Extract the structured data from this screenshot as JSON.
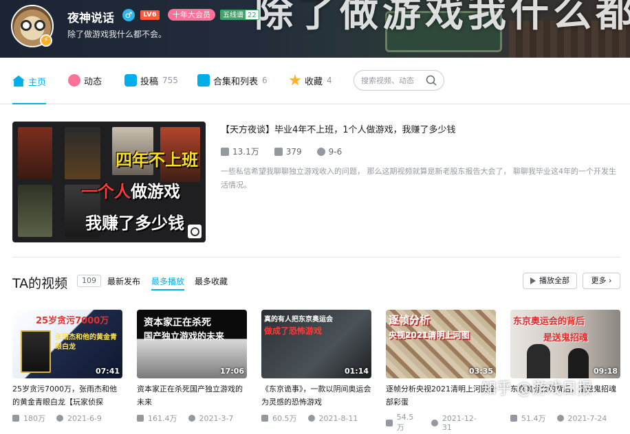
{
  "banner": {
    "background_text": "除了做游戏我什么都不会"
  },
  "user": {
    "name": "夜神说话",
    "sign": "除了做游戏我什么都不会。",
    "gender_icon": "male-icon",
    "level": "LV6",
    "vip": "十年大会员",
    "medal_name": "五线谱",
    "medal_level": "22"
  },
  "nav": {
    "items": [
      {
        "label": "主页",
        "count": "",
        "icon": "home-icon"
      },
      {
        "label": "动态",
        "count": "",
        "icon": "dynamic-icon"
      },
      {
        "label": "投稿",
        "count": "755",
        "icon": "upload-icon"
      },
      {
        "label": "合集和列表",
        "count": "6",
        "icon": "collection-icon"
      },
      {
        "label": "收藏",
        "count": "4",
        "icon": "star-icon"
      }
    ],
    "search_placeholder": "搜索视频、动态"
  },
  "featured": {
    "thumb_line1": "四年不上班",
    "thumb_line2_red": "一个人",
    "thumb_line2_rest": "做游戏",
    "thumb_line3": "我赚了多少钱",
    "title": "【天方夜谈】毕业4年不上班，1个人做游戏，我赚了多少钱",
    "views": "13.1万",
    "comments": "379",
    "date": "9-6",
    "desc": "一些私信希望我聊聊独立游戏收入的问题， 那么这期视频就算是新老股东报告大会了， 聊聊我毕业这4年的一个开发生活情况。"
  },
  "videos_section": {
    "title": "TA的视频",
    "count": "109",
    "sort_tabs": [
      "最新发布",
      "最多播放",
      "最多收藏"
    ],
    "active_sort": "最多播放",
    "play_all": "播放全部",
    "more": "更多"
  },
  "videos": [
    {
      "thumb_text": "25岁贪污7000万",
      "thumb_sub": "张雨杰和他的黄金青眼白龙",
      "duration": "07:41",
      "title": "25岁贪污7000万，张雨杰和他的黄金青眼白龙【玩家侦探",
      "views": "180万",
      "date": "2021-6-9"
    },
    {
      "thumb_text": "资本家正在杀死",
      "thumb_sub": "国产独立游戏的未来",
      "duration": "17:06",
      "title": "资本家正在杀死国产独立游戏的未来",
      "views": "161.4万",
      "date": "2021-3-7"
    },
    {
      "thumb_text": "真的有人把东京奥运会",
      "thumb_sub": "做成了恐怖游戏",
      "duration": "01:14",
      "title": "《东京诡事》，一款以阴间奥运会为灵感的恐怖游戏",
      "views": "60.5万",
      "date": "2021-8-11"
    },
    {
      "thumb_text": "逐帧分析",
      "thumb_sub": "央视2021清明上河图",
      "duration": "03:35",
      "title": "逐帧分析央视2021清明上河图全部彩蛋",
      "views": "54.5万",
      "date": "2021-12-31"
    },
    {
      "thumb_text": "东京奥运会的背后",
      "thumb_sub": "是送鬼招魂",
      "duration": "09:18",
      "title": "东京奥运会的背后，是送鬼招魂",
      "views": "51.4万",
      "date": "2021-7-24"
    }
  ],
  "watermark": "知乎 @游戏日报",
  "colors": {
    "accent": "#00aeec",
    "pink": "#fb7299",
    "text_secondary": "#9499a0"
  }
}
